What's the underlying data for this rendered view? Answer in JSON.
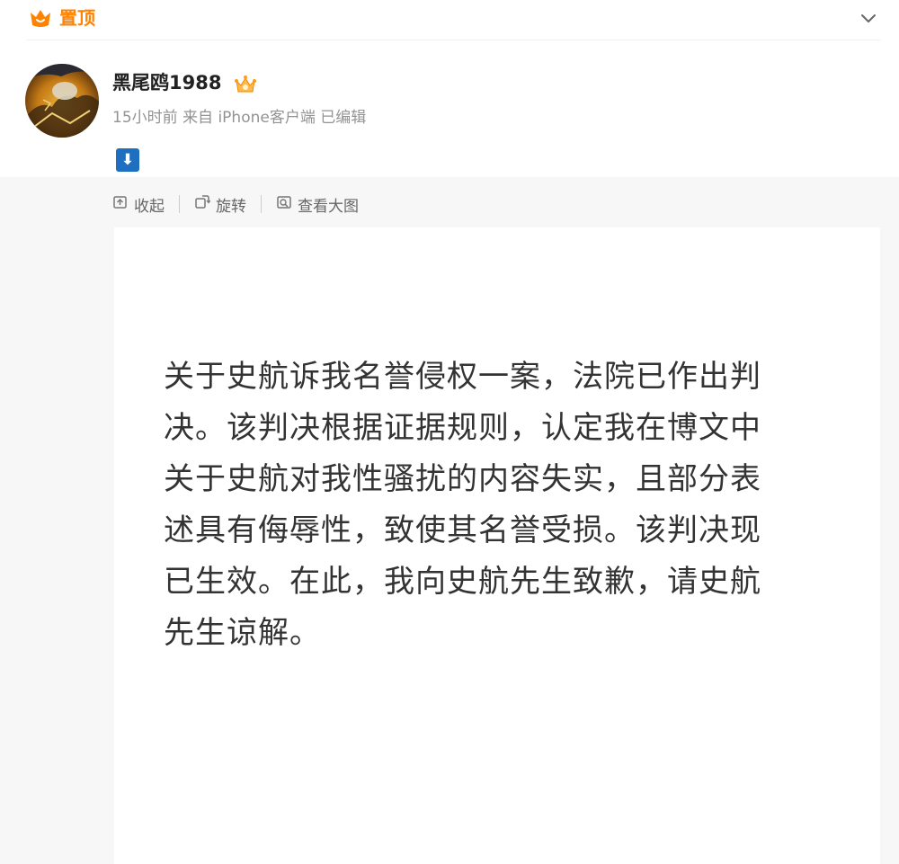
{
  "pinned": {
    "label": "置顶",
    "icon": "crown-pin-icon",
    "color": "#ff8200"
  },
  "post": {
    "author": {
      "name": "黑尾鸥1988",
      "avatar": "avatar-image",
      "badge_icon": "vip-crown-icon"
    },
    "time": "15小时前",
    "source": "来自 iPhone客户端",
    "edited": "已编辑",
    "emoji_text": "⬇"
  },
  "image_toolbar": {
    "collapse": "收起",
    "rotate": "旋转",
    "view_large": "查看大图"
  },
  "image_content": {
    "lines": [
      "关于史航诉我名誉侵权一案，法院已作出判",
      "决。该判决根据证据规则，认定我在博文中",
      "关于史航对我性骚扰的内容失实，且部分表",
      "述具有侮辱性，致使其名誉受损。该判决现",
      "已生效。在此，我向史航先生致歉，请史航",
      "先生谅解。"
    ]
  }
}
